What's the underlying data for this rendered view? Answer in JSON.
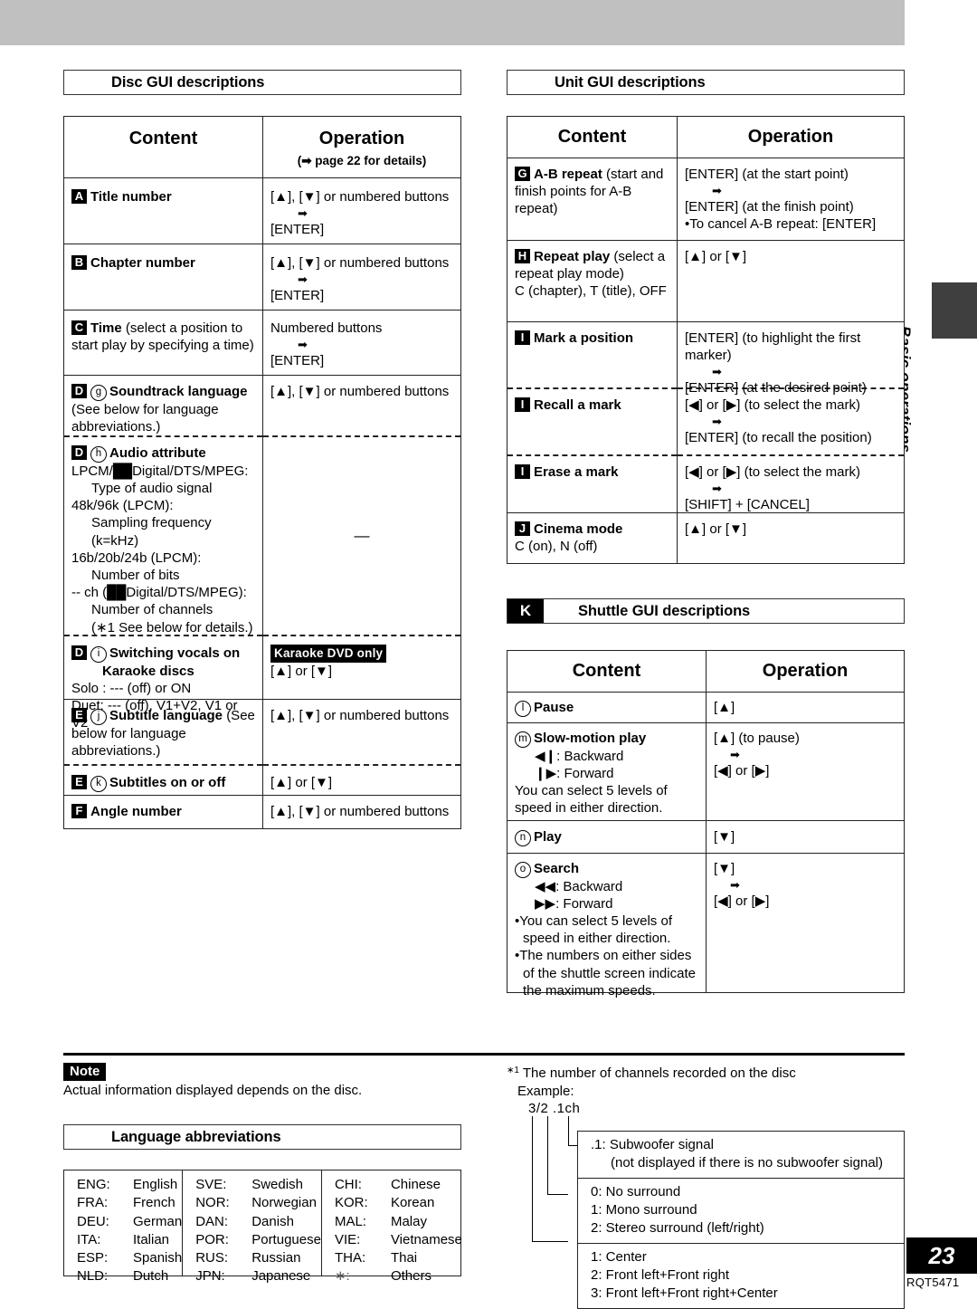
{
  "page": {
    "number": "23",
    "doc_code": "RQT5471",
    "thumb_label": "Basic operations"
  },
  "disc_section": {
    "heading": "Disc GUI descriptions",
    "table": {
      "header": {
        "content": "Content",
        "operation": "Operation",
        "operation_sub": "(➡ page 22 for details)"
      },
      "rows": [
        {
          "badge": "A",
          "title": "Title number",
          "op_line1": "[▲], [▼] or numbered buttons",
          "op_arrow": "➡",
          "op_line2": "[ENTER]"
        },
        {
          "badge": "B",
          "title": "Chapter number",
          "op_line1": "[▲], [▼] or numbered buttons",
          "op_arrow": "➡",
          "op_line2": "[ENTER]"
        },
        {
          "badge": "C",
          "title": "Time",
          "title_rest": "(select a position to start play by specifying a time)",
          "op_line1": "Numbered buttons",
          "op_arrow": "➡",
          "op_line2": "[ENTER]"
        },
        {
          "badge": "D",
          "circle": "g",
          "title": "Soundtrack language",
          "sub": "(See below for language abbreviations.)",
          "op_line1": "[▲], [▼] or numbered buttons"
        },
        {
          "badge": "D",
          "circle": "h",
          "title": "Audio attribute",
          "lines": [
            "LPCM/██Digital/DTS/MPEG:",
            "Type of audio signal",
            "48k/96k (LPCM):",
            "Sampling frequency",
            "(k=kHz)",
            "16b/20b/24b (LPCM):",
            "Number of bits",
            "-- ch (██Digital/DTS/MPEG):",
            "Number of channels",
            "(∗1 See below for details.)"
          ],
          "op_line1": "—"
        },
        {
          "badge": "D",
          "circle": "i",
          "title": "Switching vocals on",
          "title2": "Karaoke discs",
          "sub1": "Solo : --- (off) or ON",
          "sub2": "Duet: --- (off), V1+V2, V1 or V2",
          "op_tag": "Karaoke DVD only",
          "op_line1": "[▲] or [▼]"
        },
        {
          "badge": "E",
          "circle": "j",
          "title": "Subtitle language",
          "sub": "(See below for language abbreviations.)",
          "op_line1": "[▲], [▼] or numbered buttons"
        },
        {
          "badge": "E",
          "circle": "k",
          "title": "Subtitles on or off",
          "op_line1": "[▲] or [▼]"
        },
        {
          "badge": "F",
          "title": "Angle number",
          "op_line1": "[▲], [▼] or numbered buttons"
        }
      ]
    }
  },
  "unit_section": {
    "heading": "Unit GUI descriptions",
    "table": {
      "header": {
        "content": "Content",
        "operation": "Operation"
      },
      "rows": [
        {
          "badge": "G",
          "title": "A-B repeat",
          "sub": "(start and finish points for A-B repeat)",
          "op_line1": "[ENTER] (at the start point)",
          "op_arrow": "➡",
          "op_line2": "[ENTER] (at the finish point)",
          "op_bullet": "To cancel A-B repeat:  [ENTER]"
        },
        {
          "badge": "H",
          "title": "Repeat play",
          "sub": "(select a repeat play mode)",
          "sub2": "C (chapter), T (title), OFF",
          "op_line1": "[▲] or [▼]"
        },
        {
          "badge": "I",
          "title": "Mark a position",
          "op_line1": "[ENTER] (to highlight the first marker)",
          "op_arrow": "➡",
          "op_line2": "[ENTER] (at the desired point)"
        },
        {
          "badge": "I",
          "title": "Recall a mark",
          "op_line1": "[◀] or [▶] (to select the mark)",
          "op_arrow": "➡",
          "op_line2": "[ENTER] (to recall the position)"
        },
        {
          "badge": "I",
          "title": "Erase a mark",
          "op_line1": "[◀] or [▶] (to select the mark)",
          "op_arrow": "➡",
          "op_line2": "[SHIFT] + [CANCEL]"
        },
        {
          "badge": "J",
          "title": "Cinema mode",
          "sub": "C (on), N (off)",
          "op_line1": "[▲] or [▼]"
        }
      ]
    }
  },
  "shuttle_section": {
    "badge": "K",
    "heading": "Shuttle GUI descriptions",
    "table": {
      "header": {
        "content": "Content",
        "operation": "Operation"
      },
      "rows": [
        {
          "circle": "l",
          "title": "Pause",
          "op_line1": "[▲]"
        },
        {
          "circle": "m",
          "title": "Slow-motion play",
          "dir1": "◀❙:  Backward",
          "dir2": "❙▶:  Forward",
          "sub": "You can select 5 levels of speed in either direction.",
          "op_line1": "[▲] (to pause)",
          "op_arrow": "➡",
          "op_line2": "[◀] or [▶]"
        },
        {
          "circle": "n",
          "title": "Play",
          "op_line1": "[▼]"
        },
        {
          "circle": "o",
          "title": "Search",
          "dir1": "◀◀:  Backward",
          "dir2": "▶▶:  Forward",
          "bullet1": "You can select 5 levels of speed in either direction.",
          "bullet2": "The numbers on either sides of the shuttle screen indicate the maximum speeds.",
          "op_line1": "[▼]",
          "op_arrow": "➡",
          "op_line2": "[◀] or [▶]"
        }
      ]
    }
  },
  "note": {
    "tag": "Note",
    "text": "Actual information displayed depends on the disc."
  },
  "language_section": {
    "heading": "Language abbreviations",
    "columns": [
      [
        {
          "abbr": "ENG:",
          "name": "English"
        },
        {
          "abbr": "FRA:",
          "name": "French"
        },
        {
          "abbr": "DEU:",
          "name": "German"
        },
        {
          "abbr": "ITA:",
          "name": "Italian"
        },
        {
          "abbr": "ESP:",
          "name": "Spanish"
        },
        {
          "abbr": "NLD:",
          "name": "Dutch"
        }
      ],
      [
        {
          "abbr": "SVE:",
          "name": "Swedish"
        },
        {
          "abbr": "NOR:",
          "name": "Norwegian"
        },
        {
          "abbr": "DAN:",
          "name": "Danish"
        },
        {
          "abbr": "POR:",
          "name": "Portuguese"
        },
        {
          "abbr": "RUS:",
          "name": "Russian"
        },
        {
          "abbr": "JPN:",
          "name": "Japanese"
        }
      ],
      [
        {
          "abbr": "CHI:",
          "name": "Chinese"
        },
        {
          "abbr": "KOR:",
          "name": "Korean"
        },
        {
          "abbr": "MAL:",
          "name": "Malay"
        },
        {
          "abbr": "VIE:",
          "name": "Vietnamese"
        },
        {
          "abbr": "THA:",
          "name": "Thai"
        },
        {
          "abbr": "∗:",
          "name": "Others"
        }
      ]
    ]
  },
  "channel_note": {
    "footnote_mark": "∗1",
    "title": "The number of channels recorded on the disc",
    "example_label": "Example:",
    "example_value": "3/2 .1ch",
    "blocks": [
      {
        "lines": [
          ".1:  Subwoofer signal",
          "(not displayed if there is no subwoofer signal)"
        ]
      },
      {
        "lines": [
          "0:  No surround",
          "1:  Mono surround",
          "2:  Stereo surround (left/right)"
        ]
      },
      {
        "lines": [
          "1:  Center",
          "2:  Front left+Front right",
          "3:  Front left+Front right+Center"
        ]
      }
    ]
  }
}
